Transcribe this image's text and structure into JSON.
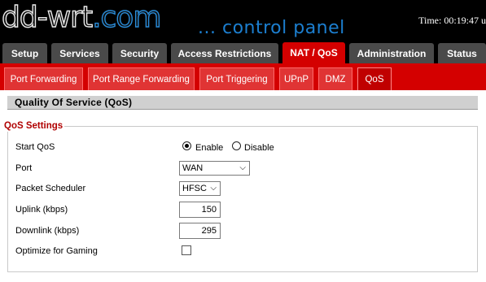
{
  "header": {
    "logo_main": "dd-wrt",
    "logo_tld": ".com",
    "tagline": "... control panel",
    "time_text": "Time: 00:19:47 u"
  },
  "main_tabs": [
    {
      "label": "Setup"
    },
    {
      "label": "Services"
    },
    {
      "label": "Security"
    },
    {
      "label": "Access Restrictions"
    },
    {
      "label": "NAT / QoS",
      "active": true
    },
    {
      "label": "Administration"
    },
    {
      "label": "Status"
    }
  ],
  "sub_tabs": [
    {
      "label": "Port Forwarding"
    },
    {
      "label": "Port Range Forwarding"
    },
    {
      "label": "Port Triggering"
    },
    {
      "label": "UPnP"
    },
    {
      "label": "DMZ"
    },
    {
      "label": "QoS",
      "active": true
    }
  ],
  "section": {
    "title": "Quality Of Service (QoS)",
    "legend": "QoS Settings"
  },
  "settings": {
    "start_qos": {
      "label": "Start QoS",
      "options": [
        "Enable",
        "Disable"
      ],
      "selected": "Enable"
    },
    "port": {
      "label": "Port",
      "value": "WAN"
    },
    "scheduler": {
      "label": "Packet Scheduler",
      "value": "HFSC"
    },
    "uplink": {
      "label": "Uplink (kbps)",
      "value": "150"
    },
    "downlink": {
      "label": "Downlink (kbps)",
      "value": "295"
    },
    "gaming": {
      "label": "Optimize for Gaming",
      "checked": false
    }
  },
  "colors": {
    "header_bg": "#000000",
    "active_tab": "#d40000",
    "inactive_tab": "#4a4a4a",
    "subtab_bar": "#d40000",
    "legend_text": "#b00000",
    "logo_accent": "#1c7fd0"
  }
}
